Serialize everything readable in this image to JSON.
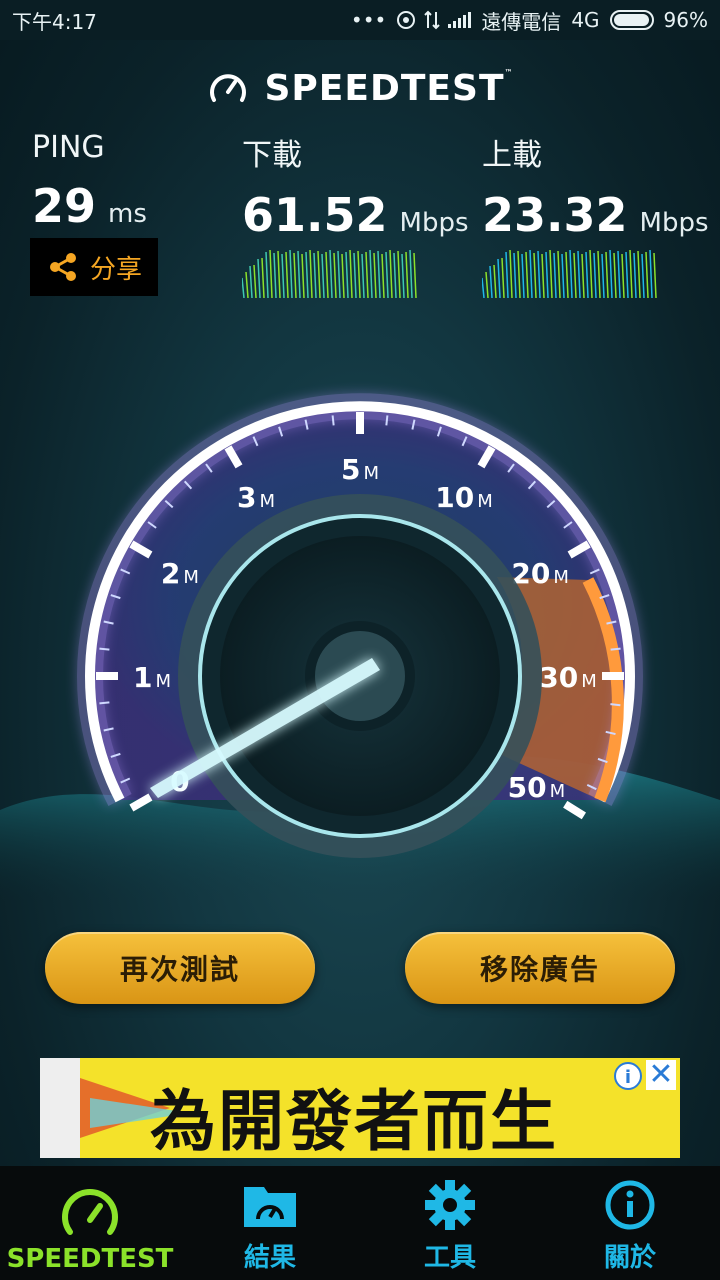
{
  "status_bar": {
    "time": "下午4:17",
    "dots": "•••",
    "carrier": "遠傳電信",
    "network": "4G",
    "battery": "96%"
  },
  "brand": {
    "title": "SPEEDTEST",
    "trademark": "™"
  },
  "metrics": {
    "ping": {
      "label": "PING",
      "value": "29",
      "unit": "ms"
    },
    "download": {
      "label": "下載",
      "value": "61.52",
      "unit": "Mbps"
    },
    "upload": {
      "label": "上載",
      "value": "23.32",
      "unit": "Mbps"
    }
  },
  "share": {
    "label": "分享",
    "icon": "share-icon"
  },
  "gauge": {
    "scale_labels": [
      {
        "num": "0",
        "unit": ""
      },
      {
        "num": "1",
        "unit": "M"
      },
      {
        "num": "2",
        "unit": "M"
      },
      {
        "num": "3",
        "unit": "M"
      },
      {
        "num": "5",
        "unit": "M"
      },
      {
        "num": "10",
        "unit": "M"
      },
      {
        "num": "20",
        "unit": "M"
      },
      {
        "num": "30",
        "unit": "M"
      },
      {
        "num": "50",
        "unit": "M"
      }
    ],
    "needle_value_index": 0
  },
  "buttons": {
    "retest": "再次測試",
    "remove_ads": "移除廣告"
  },
  "ad": {
    "text": "為開發者而生",
    "info": "i",
    "close": "✕"
  },
  "tabs": [
    {
      "label": "SPEEDTEST",
      "icon": "speedometer-icon",
      "color": "#8be22a",
      "active": true
    },
    {
      "label": "結果",
      "icon": "results-folder-icon",
      "color": "#1fb8e6"
    },
    {
      "label": "工具",
      "icon": "gear-icon",
      "color": "#1fb8e6"
    },
    {
      "label": "關於",
      "icon": "info-icon",
      "color": "#1fb8e6"
    }
  ],
  "colors": {
    "accent_orange": "#f5a623",
    "accent_green": "#8be22a",
    "accent_cyan": "#1fb8e6"
  }
}
